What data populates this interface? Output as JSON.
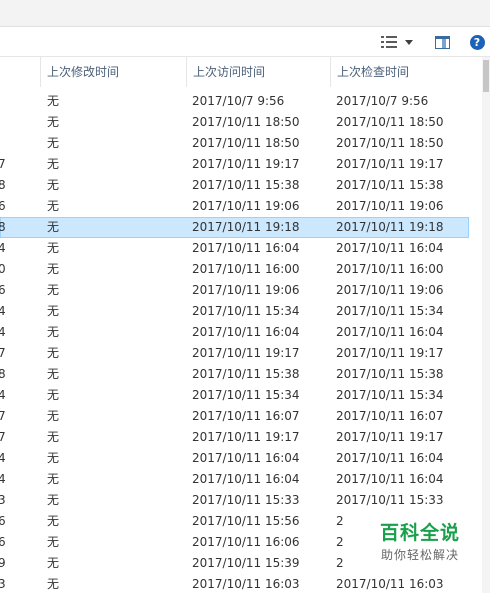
{
  "columns": [
    "上次修改时间",
    "上次访问时间",
    "上次检查时间"
  ],
  "rows": [
    {
      "edge": "",
      "modified": "无",
      "accessed": "2017/10/7 9:56",
      "checked": "2017/10/7 9:56"
    },
    {
      "edge": "",
      "modified": "无",
      "accessed": "2017/10/11 18:50",
      "checked": "2017/10/11 18:50"
    },
    {
      "edge": "",
      "modified": "无",
      "accessed": "2017/10/11 18:50",
      "checked": "2017/10/11 18:50"
    },
    {
      "edge": "7",
      "modified": "无",
      "accessed": "2017/10/11 19:17",
      "checked": "2017/10/11 19:17"
    },
    {
      "edge": "8",
      "modified": "无",
      "accessed": "2017/10/11 15:38",
      "checked": "2017/10/11 15:38"
    },
    {
      "edge": "6",
      "modified": "无",
      "accessed": "2017/10/11 19:06",
      "checked": "2017/10/11 19:06"
    },
    {
      "edge": "8",
      "modified": "无",
      "accessed": "2017/10/11 19:18",
      "checked": "2017/10/11 19:18"
    },
    {
      "edge": "4",
      "modified": "无",
      "accessed": "2017/10/11 16:04",
      "checked": "2017/10/11 16:04"
    },
    {
      "edge": "0",
      "modified": "无",
      "accessed": "2017/10/11 16:00",
      "checked": "2017/10/11 16:00"
    },
    {
      "edge": "6",
      "modified": "无",
      "accessed": "2017/10/11 19:06",
      "checked": "2017/10/11 19:06"
    },
    {
      "edge": "4",
      "modified": "无",
      "accessed": "2017/10/11 15:34",
      "checked": "2017/10/11 15:34"
    },
    {
      "edge": "4",
      "modified": "无",
      "accessed": "2017/10/11 16:04",
      "checked": "2017/10/11 16:04"
    },
    {
      "edge": "7",
      "modified": "无",
      "accessed": "2017/10/11 19:17",
      "checked": "2017/10/11 19:17"
    },
    {
      "edge": "8",
      "modified": "无",
      "accessed": "2017/10/11 15:38",
      "checked": "2017/10/11 15:38"
    },
    {
      "edge": "4",
      "modified": "无",
      "accessed": "2017/10/11 15:34",
      "checked": "2017/10/11 15:34"
    },
    {
      "edge": "7",
      "modified": "无",
      "accessed": "2017/10/11 16:07",
      "checked": "2017/10/11 16:07"
    },
    {
      "edge": "7",
      "modified": "无",
      "accessed": "2017/10/11 19:17",
      "checked": "2017/10/11 19:17"
    },
    {
      "edge": "4",
      "modified": "无",
      "accessed": "2017/10/11 16:04",
      "checked": "2017/10/11 16:04"
    },
    {
      "edge": "4",
      "modified": "无",
      "accessed": "2017/10/11 16:04",
      "checked": "2017/10/11 16:04"
    },
    {
      "edge": "3",
      "modified": "无",
      "accessed": "2017/10/11 15:33",
      "checked": "2017/10/11 15:33"
    },
    {
      "edge": "6",
      "modified": "无",
      "accessed": "2017/10/11 15:56",
      "checked": "2"
    },
    {
      "edge": "6",
      "modified": "无",
      "accessed": "2017/10/11 16:06",
      "checked": "2"
    },
    {
      "edge": "9",
      "modified": "无",
      "accessed": "2017/10/11 15:39",
      "checked": "2"
    },
    {
      "edge": "3",
      "modified": "无",
      "accessed": "2017/10/11 16:03",
      "checked": "2017/10/11 16:03"
    }
  ],
  "selected_row": 6,
  "watermark": {
    "title": "百科全说",
    "subtitle": "助你轻松解决"
  },
  "colors": {
    "selection": "#cce8ff",
    "selection_border": "#99d1ff",
    "header_text": "#4c607a",
    "watermark": "#19a04a"
  },
  "icons": [
    "view-options-icon",
    "chevron-down-icon",
    "preview-pane-icon",
    "help-icon"
  ]
}
